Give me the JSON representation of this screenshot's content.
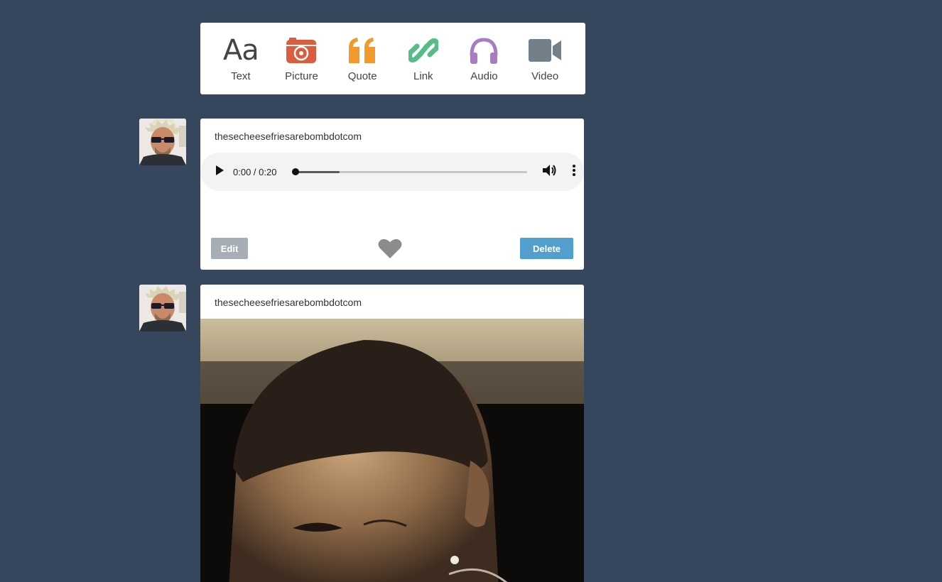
{
  "composer": {
    "types": [
      {
        "label": "Text",
        "icon": "text-icon",
        "color": "#444444"
      },
      {
        "label": "Picture",
        "icon": "camera-icon",
        "color": "#d95e40"
      },
      {
        "label": "Quote",
        "icon": "quote-icon",
        "color": "#f2992e"
      },
      {
        "label": "Link",
        "icon": "link-icon",
        "color": "#56bc8a"
      },
      {
        "label": "Audio",
        "icon": "headphones-icon",
        "color": "#a77dc2"
      },
      {
        "label": "Video",
        "icon": "video-camera-icon",
        "color": "#748089"
      }
    ],
    "text_glyph": "Aa"
  },
  "posts": [
    {
      "username": "thesecheesefriesarebombdotcom",
      "type": "audio",
      "audio": {
        "time": "0:00 / 0:20",
        "buffered_fraction": 0.19
      },
      "edit_label": "Edit",
      "delete_label": "Delete"
    },
    {
      "username": "thesecheesefriesarebombdotcom",
      "type": "photo"
    }
  ],
  "colors": {
    "background": "#36465d",
    "delete_button": "#529ecc",
    "edit_button": "#a6adb4"
  }
}
